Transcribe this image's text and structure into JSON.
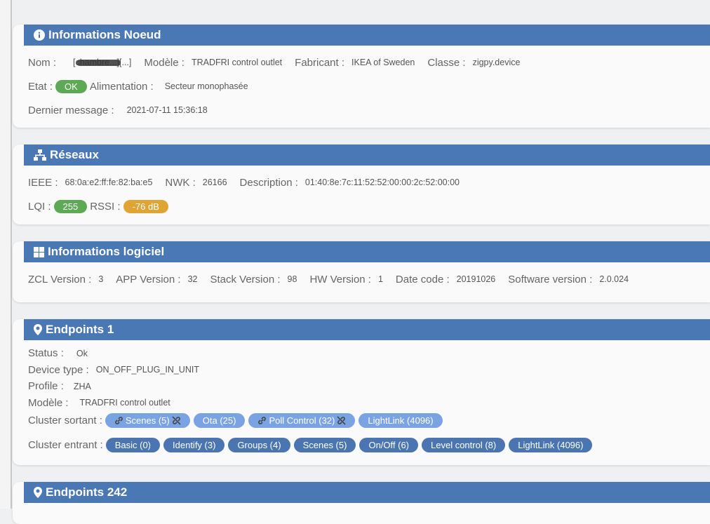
{
  "node": {
    "title": "Informations Noeud",
    "nom_label": "Nom :",
    "nom_value": "[chambre...][...]",
    "modele_label": "Modèle :",
    "modele_value": "TRADFRI control outlet",
    "fabricant_label": "Fabricant :",
    "fabricant_value": "IKEA of Sweden",
    "classe_label": "Classe :",
    "classe_value": "zigpy.device",
    "etat_label": "Etat :",
    "etat_value": "OK",
    "alim_label": "Alimentation :",
    "alim_value": "Secteur monophasée",
    "dernier_label": "Dernier message :",
    "dernier_value": "2021-07-11 15:36:18"
  },
  "reseaux": {
    "title": "Réseaux",
    "ieee_label": "IEEE :",
    "ieee_value": "68:0a:e2:ff:fe:82:ba:e5",
    "nwk_label": "NWK :",
    "nwk_value": "26166",
    "desc_label": "Description :",
    "desc_value": "01:40:8e:7c:11:52:52:00:00:2c:52:00:00",
    "lqi_label": "LQI :",
    "lqi_value": "255",
    "rssi_label": "RSSI :",
    "rssi_value": "-76 dB"
  },
  "logiciel": {
    "title": "Informations logiciel",
    "items": [
      {
        "label": "ZCL Version :",
        "value": "3"
      },
      {
        "label": "APP Version :",
        "value": "32"
      },
      {
        "label": "Stack Version :",
        "value": "98"
      },
      {
        "label": "HW Version :",
        "value": "1"
      },
      {
        "label": "Date code :",
        "value": "20191026"
      },
      {
        "label": "Software version :",
        "value": "2.0.024"
      }
    ]
  },
  "ep1": {
    "title": "Endpoints 1",
    "status_label": "Status :",
    "status_value": "Ok",
    "type_label": "Device type :",
    "type_value": "ON_OFF_PLUG_IN_UNIT",
    "profile_label": "Profile :",
    "profile_value": "ZHA",
    "modele_label": "Modèle :",
    "modele_value": "TRADFRI control outlet",
    "out_label": "Cluster sortant :",
    "out": [
      "Scenes (5)",
      "Ota (25)",
      "Poll Control (32)",
      "LightLink (4096)"
    ],
    "in_label": "Cluster entrant :",
    "in": [
      "Basic (0)",
      "Identify (3)",
      "Groups (4)",
      "Scenes (5)",
      "On/Off (6)",
      "Level control (8)",
      "LightLink (4096)"
    ]
  },
  "ep242": {
    "title": "Endpoints 242"
  },
  "colors": {
    "header": "#4a78b4",
    "ok": "#5ea956",
    "warn": "#e0a435"
  }
}
